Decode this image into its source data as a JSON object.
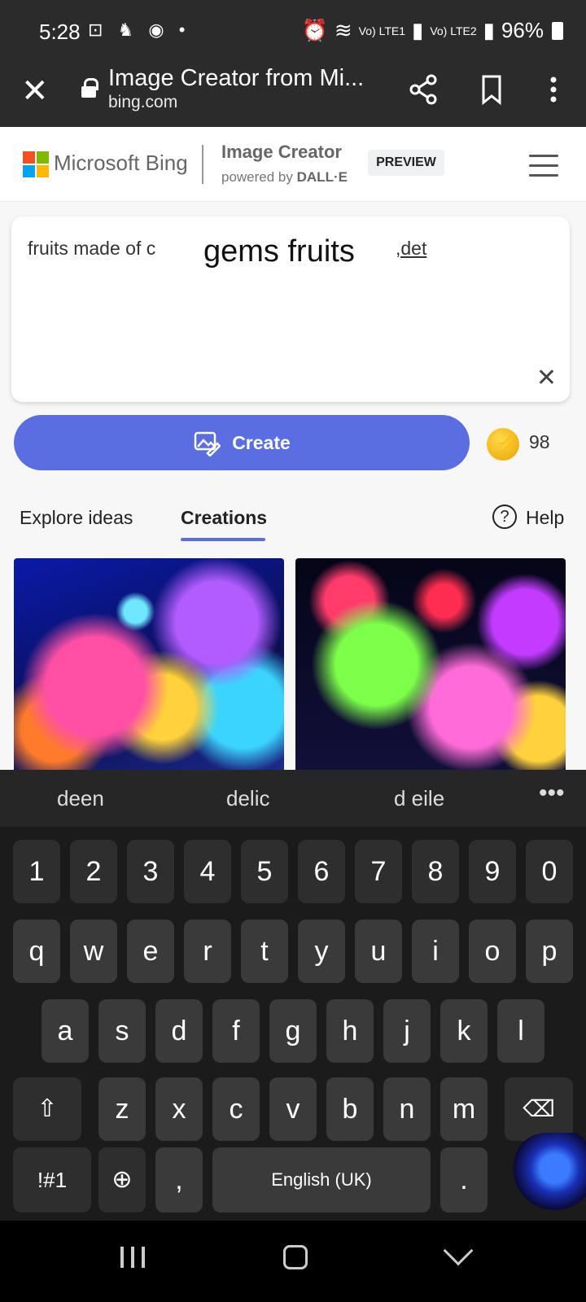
{
  "status_bar": {
    "time": "5:28",
    "left_icons": "⊡ ♞ ◉ •",
    "sim1": "Vo) LTE1",
    "sim2": "Vo) LTE2",
    "battery": "96%"
  },
  "browser": {
    "title": "Image Creator from Mi...",
    "host": "bing.com"
  },
  "bing_header": {
    "brand": "Microsoft Bing",
    "product_title": "Image Creator",
    "powered_by": "powered by",
    "powered_by_brand": "DALL·E",
    "badge": "PREVIEW"
  },
  "prompt": {
    "text": "fruits made of c",
    "overlay": "gems fruits",
    "suffix": ",det"
  },
  "create": {
    "label": "Create",
    "boost_count": "98"
  },
  "tabs": {
    "explore": "Explore ideas",
    "creations": "Creations",
    "help": "Help"
  },
  "keyboard": {
    "suggestions": [
      "deen",
      "delic",
      "d eile"
    ],
    "row_numbers": [
      "1",
      "2",
      "3",
      "4",
      "5",
      "6",
      "7",
      "8",
      "9",
      "0"
    ],
    "row_top": [
      "q",
      "w",
      "e",
      "r",
      "t",
      "y",
      "u",
      "i",
      "o",
      "p"
    ],
    "row_mid": [
      "a",
      "s",
      "d",
      "f",
      "g",
      "h",
      "j",
      "k",
      "l"
    ],
    "row_bot": [
      "z",
      "x",
      "c",
      "v",
      "b",
      "n",
      "m"
    ],
    "symbols": "!#1",
    "comma": ",",
    "space": "English (UK)",
    "period": "."
  },
  "colors": {
    "accent": "#5b6ee1",
    "chrome": "#2b2b2b"
  }
}
